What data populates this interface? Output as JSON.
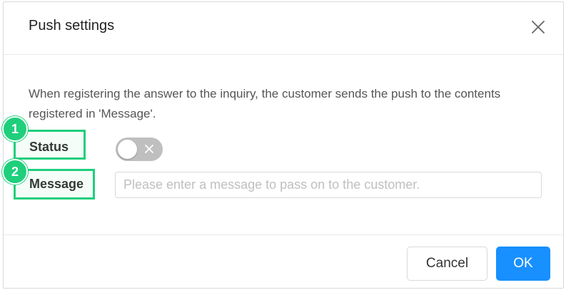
{
  "dialog": {
    "title": "Push settings",
    "close_icon": "close-icon"
  },
  "body": {
    "description": "When registering the answer to the inquiry, the customer sends the push to the contents registered in 'Message'.",
    "status": {
      "label": "Status",
      "toggle_on": false,
      "toggle_icon": "x-icon"
    },
    "message": {
      "label": "Message",
      "value": "",
      "placeholder": "Please enter a message to pass on to the customer."
    }
  },
  "footer": {
    "cancel_label": "Cancel",
    "ok_label": "OK"
  },
  "annotations": [
    {
      "number": "1"
    },
    {
      "number": "2"
    }
  ],
  "colors": {
    "primary": "#1890ff",
    "annotation": "#1fcf7c",
    "toggle_off": "#bfbfbf"
  }
}
